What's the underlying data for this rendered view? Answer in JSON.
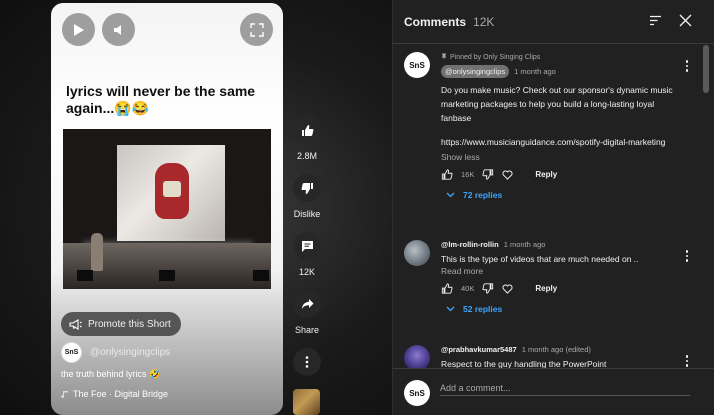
{
  "short": {
    "title": "lyrics will never be the same again...😭😂",
    "promote_label": "Promote this Short",
    "channel_avatar_text": "SnS",
    "channel_name": "@onlysingingclips",
    "caption": "the truth behind lyrics 🤣",
    "music": "The Foe · Digital Bridge"
  },
  "actions": {
    "like_count": "2.8M",
    "dislike_label": "Dislike",
    "comments_count": "12K",
    "share_label": "Share"
  },
  "comments": {
    "title": "Comments",
    "count": "12K",
    "items": [
      {
        "pinned_label": "Pinned by Only Singing Clips",
        "author": "@onlysingingclips",
        "time": "1 month ago",
        "text": "Do you make music? Check out our sponsor's dynamic music marketing packages to help you build a long-lasting loyal fanbase",
        "link": "https://www.musicianguidance.com/spotify-digital-marketing",
        "toggle": "Show less",
        "likes": "16K",
        "reply_label": "Reply",
        "replies": "72 replies"
      },
      {
        "author": "@lm-rollin-rollin",
        "time": "1 month ago",
        "text": "This is the type of videos that are much needed on ..",
        "toggle": "Read more",
        "likes": "40K",
        "reply_label": "Reply",
        "replies": "52 replies"
      },
      {
        "author": "@prabhavkumar5487",
        "time": "1 month ago (edited)",
        "text": "Respect to the guy handling the PowerPoint"
      }
    ],
    "add_placeholder": "Add a comment..."
  },
  "colors": {
    "accent_link": "#3ea6ff",
    "panel_bg": "#212121",
    "page_bg": "#0f0f0f"
  }
}
